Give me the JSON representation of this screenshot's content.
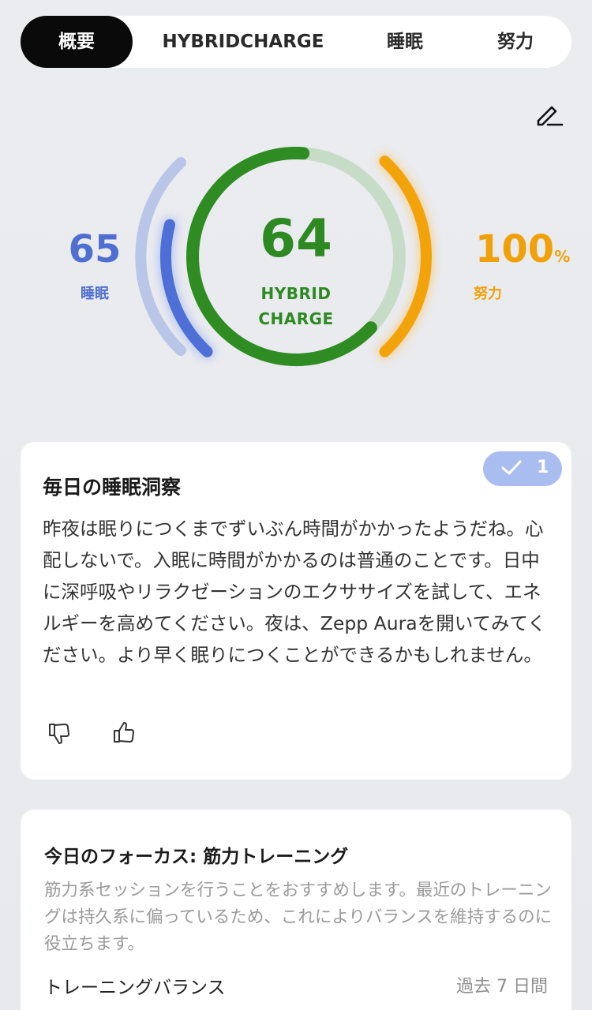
{
  "tabs": [
    {
      "label": "概要",
      "active": true
    },
    {
      "label": "HYBRIDCHARGE",
      "active": false
    },
    {
      "label": "睡眠",
      "active": false
    },
    {
      "label": "努力",
      "active": false
    }
  ],
  "edit": {
    "icon": "pencil-icon"
  },
  "gauges": {
    "hybrid": {
      "value": "64",
      "label_line1": "HYBRID",
      "label_line2": "CHARGE",
      "level": 0.64,
      "color": "#2d8a22"
    },
    "sleep": {
      "value": "65",
      "label": "睡眠",
      "level": 0.65,
      "color": "#4f6fd0"
    },
    "effort": {
      "value": "100",
      "unit": "%",
      "label": "努力",
      "level": 1.0,
      "color": "#f0a10a"
    }
  },
  "insight_card": {
    "badge_icon": "check-icon",
    "badge_count": "1",
    "title": "毎日の睡眠洞察",
    "body": "昨夜は眠りにつくまでずいぶん時間がかかったようだね。心配しないで。入眠に時間がかかるのは普通のことです。日中に深呼吸やリラクゼーションのエクササイズを試して、エネルギーを高めてください。夜は、Zepp Auraを開いてみてください。より早く眠りにつくことができるかもしれません。",
    "dislike_icon": "thumbs-down-icon",
    "like_icon": "thumbs-up-icon"
  },
  "focus_card": {
    "title": "今日のフォーカス: 筋力トレーニング",
    "body": "筋力系セッションを行うことをおすすめします。最近のトレーニングは持久系に偏っているため、これによりバランスを維持するのに役立ちます。",
    "balance_label": "トレーニングバランス",
    "period": "過去 7 日間"
  },
  "colors": {
    "accent_green": "#2d8a22",
    "sleep_blue": "#4f6fd0",
    "effort_orange": "#f0a10a",
    "badge": "#aabdf1"
  }
}
